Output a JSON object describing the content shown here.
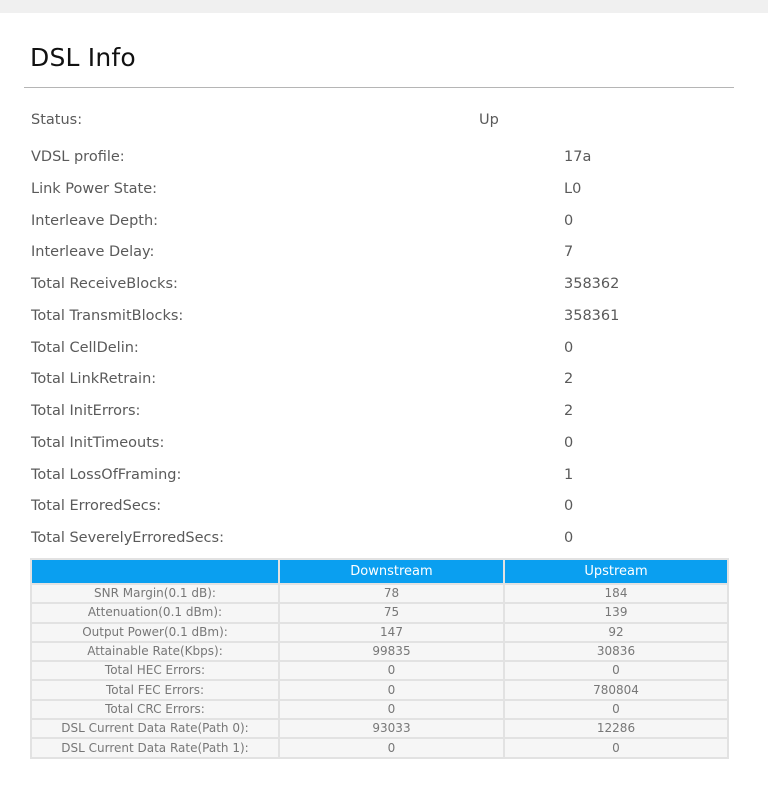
{
  "page": {
    "title": "DSL Info"
  },
  "status": {
    "label": "Status:",
    "value": "Up"
  },
  "info_rows": [
    {
      "label": "VDSL profile:",
      "value": "17a"
    },
    {
      "label": "Link Power State:",
      "value": "L0"
    },
    {
      "label": "Interleave Depth:",
      "value": "0"
    },
    {
      "label": "Interleave Delay:",
      "value": "7"
    },
    {
      "label": "Total ReceiveBlocks:",
      "value": "358362"
    },
    {
      "label": "Total TransmitBlocks:",
      "value": "358361"
    },
    {
      "label": "Total CellDelin:",
      "value": "0"
    },
    {
      "label": "Total LinkRetrain:",
      "value": "2"
    },
    {
      "label": "Total InitErrors:",
      "value": "2"
    },
    {
      "label": "Total InitTimeouts:",
      "value": "0"
    },
    {
      "label": "Total LossOfFraming:",
      "value": "1"
    },
    {
      "label": "Total ErroredSecs:",
      "value": "0"
    },
    {
      "label": "Total SeverelyErroredSecs:",
      "value": "0"
    }
  ],
  "table": {
    "headers": [
      "",
      "Downstream",
      "Upstream"
    ],
    "rows": [
      {
        "label": "SNR Margin(0.1 dB):",
        "down": "78",
        "up": "184"
      },
      {
        "label": "Attenuation(0.1 dBm):",
        "down": "75",
        "up": "139"
      },
      {
        "label": "Output Power(0.1 dBm):",
        "down": "147",
        "up": "92"
      },
      {
        "label": "Attainable Rate(Kbps):",
        "down": "99835",
        "up": "30836"
      },
      {
        "label": "Total HEC Errors:",
        "down": "0",
        "up": "0"
      },
      {
        "label": "Total FEC Errors:",
        "down": "0",
        "up": "780804"
      },
      {
        "label": "Total CRC Errors:",
        "down": "0",
        "up": "0"
      },
      {
        "label": "DSL Current Data Rate(Path 0):",
        "down": "93033",
        "up": "12286"
      },
      {
        "label": "DSL Current Data Rate(Path 1):",
        "down": "0",
        "up": "0"
      }
    ]
  },
  "colors": {
    "header_blue": "#0a9ff0",
    "label_gray": "#5a5a5a"
  }
}
